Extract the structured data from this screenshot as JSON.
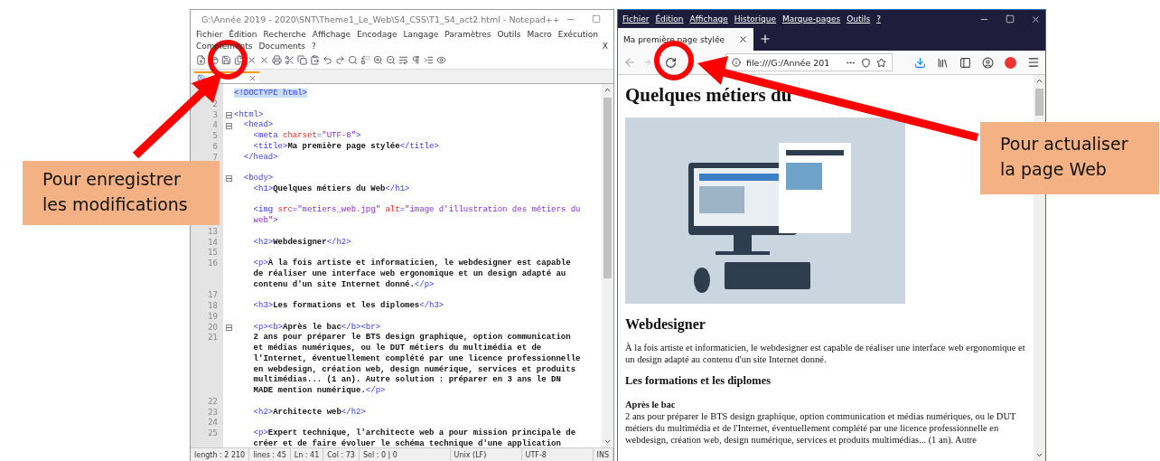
{
  "editor": {
    "title": "G:\\Année 2019 - 2020\\SNT\\Theme1_Le_Web\\S4_CSS\\T1_S4_act2.html - Notepad++",
    "menu": [
      "Fichier",
      "Édition",
      "Recherche",
      "Affichage",
      "Encodage",
      "Langage",
      "Paramètres",
      "Outils",
      "Macro",
      "Exécution"
    ],
    "menu_row2": [
      "Compléments",
      "Documents",
      "?"
    ],
    "close_doc": "X",
    "lines": [
      {
        "tokens": [
          {
            "kind": "brace",
            "text": "<!DOCTYPE html>"
          }
        ]
      },
      {
        "number": "2"
      },
      {
        "number": "3",
        "fold": true,
        "tokens": [
          {
            "kind": "tag",
            "text": "<html>"
          }
        ]
      },
      {
        "number": "4",
        "fold": true,
        "tokens": [
          {
            "kind": "tag",
            "text": "  <head>"
          }
        ]
      },
      {
        "number": "5",
        "tokens": [
          {
            "kind": "tag",
            "text": "    <meta "
          },
          {
            "kind": "attr",
            "text": "charset"
          },
          {
            "kind": "tag",
            "text": "="
          },
          {
            "kind": "value",
            "text": "\"UTF-8\""
          },
          {
            "kind": "tag",
            "text": ">"
          }
        ]
      },
      {
        "number": "6",
        "tokens": [
          {
            "kind": "tag",
            "text": "    <title>"
          },
          {
            "kind": "text",
            "text": "Ma première page stylée"
          },
          {
            "kind": "tag",
            "text": "</title>"
          }
        ]
      },
      {
        "number": "7",
        "blank_after": true,
        "tokens": [
          {
            "kind": "tag",
            "text": "  </head>"
          }
        ]
      },
      {
        "fold": true,
        "tokens": [
          {
            "kind": "tag",
            "text": "  <body>"
          }
        ]
      },
      {
        "blank_after": true,
        "tokens": [
          {
            "kind": "tag",
            "text": "    <h1>"
          },
          {
            "kind": "text",
            "text": "Quelques métiers du Web"
          },
          {
            "kind": "tag",
            "text": "</h1>"
          }
        ]
      },
      {
        "tokens": [
          {
            "kind": "tag",
            "text": "    <img "
          },
          {
            "kind": "attr",
            "text": "src"
          },
          {
            "kind": "tag",
            "text": "="
          },
          {
            "kind": "value",
            "text": "\"metiers_web.jpg\" "
          },
          {
            "kind": "attr",
            "text": "alt"
          },
          {
            "kind": "tag",
            "text": "="
          },
          {
            "kind": "value",
            "text": "\"image d'illustration des métiers du"
          }
        ]
      },
      {
        "tokens": [
          {
            "kind": "value",
            "text": "    web\""
          },
          {
            "kind": "tag",
            "text": ">"
          }
        ]
      },
      {
        "number": "13"
      },
      {
        "number": "14",
        "tokens": [
          {
            "kind": "tag",
            "text": "    <h2>"
          },
          {
            "kind": "text",
            "text": "Webdesigner"
          },
          {
            "kind": "tag",
            "text": "</h2>"
          }
        ]
      },
      {
        "number": "15"
      },
      {
        "number": "16",
        "tokens": [
          {
            "kind": "tag",
            "text": "    <p>"
          },
          {
            "kind": "text",
            "text": "À la fois artiste et informaticien, le webdesigner est capable"
          }
        ]
      },
      {
        "tokens": [
          {
            "kind": "text",
            "text": "    de réaliser une interface web ergonomique et un design adapté au"
          }
        ]
      },
      {
        "tokens": [
          {
            "kind": "text",
            "text": "    contenu d'un site Internet donné."
          },
          {
            "kind": "tag",
            "text": "</p>"
          }
        ]
      },
      {
        "number": "17"
      },
      {
        "number": "18",
        "tokens": [
          {
            "kind": "tag",
            "text": "    <h3>"
          },
          {
            "kind": "text",
            "text": "Les formations et les diplomes"
          },
          {
            "kind": "tag",
            "text": "</h3>"
          }
        ]
      },
      {
        "number": "19"
      },
      {
        "number": "20",
        "fold": true,
        "tokens": [
          {
            "kind": "tag",
            "text": "    <p><b>"
          },
          {
            "kind": "text",
            "text": "Après le bac"
          },
          {
            "kind": "tag",
            "text": "</b><br>"
          }
        ]
      },
      {
        "number": "21",
        "tokens": [
          {
            "kind": "text",
            "text": "    2 ans pour préparer le BTS design graphique, option communication"
          }
        ]
      },
      {
        "tokens": [
          {
            "kind": "text",
            "text": "    et médias numériques, ou le DUT métiers du multimédia et de"
          }
        ]
      },
      {
        "tokens": [
          {
            "kind": "text",
            "text": "    l'Internet, éventuellement complété par une licence professionnelle"
          }
        ]
      },
      {
        "tokens": [
          {
            "kind": "text",
            "text": "    en webdesign, création web, design numérique, services et produits"
          }
        ]
      },
      {
        "tokens": [
          {
            "kind": "text",
            "text": "    multimédias... (1 an). Autre solution : préparer en 3 ans le DN"
          }
        ]
      },
      {
        "tokens": [
          {
            "kind": "text",
            "text": "    MADE mention numérique."
          },
          {
            "kind": "tag",
            "text": "</p>"
          }
        ]
      },
      {
        "number": "22"
      },
      {
        "number": "23",
        "tokens": [
          {
            "kind": "tag",
            "text": "    <h2>"
          },
          {
            "kind": "text",
            "text": "Architecte web"
          },
          {
            "kind": "tag",
            "text": "</h2>"
          }
        ]
      },
      {
        "number": "24"
      },
      {
        "number": "25",
        "tokens": [
          {
            "kind": "tag",
            "text": "    <p>"
          },
          {
            "kind": "text",
            "text": "Expert technique, l'architecte web a pour mission principale de"
          }
        ]
      },
      {
        "tokens": [
          {
            "kind": "text",
            "text": "    créer et de faire évoluer le schéma technique d'une application"
          }
        ]
      }
    ],
    "status": [
      "length : 2 210",
      "lines : 45",
      "Ln : 41",
      "Col : 73",
      "Sel : 0 | 0",
      "Unix (LF)",
      "UTF-8",
      "INS"
    ]
  },
  "browser": {
    "menu": [
      "Fichier",
      "Édition",
      "Affichage",
      "Historique",
      "Marque-pages",
      "Outils",
      "?"
    ],
    "tab": "Ma première page stylée",
    "url": "file:///G:/Année 201",
    "page": {
      "h1": "Quelques métiers du",
      "h2": "Webdesigner",
      "p1": "À la fois artiste et informaticien, le webdesigner est capable de réaliser une interface web ergonomique et un design adapté au contenu d'un site Internet donné.",
      "h3": "Les formations et les diplomes",
      "p2": "**Après le bac**",
      "p2_text": "2 ans pour préparer le BTS design graphique, option communication et médias numériques, ou le DUT métiers du multimédia et de l'Internet, éventuellement complété par une licence professionnelle en webdesign, création web, design numérique, services et produits multimédias... (1 an). Autre"
    }
  },
  "callouts": [
    {
      "text": "Pour enregistrer les modifications"
    },
    {
      "text": "Pour actualiser la page Web"
    }
  ]
}
